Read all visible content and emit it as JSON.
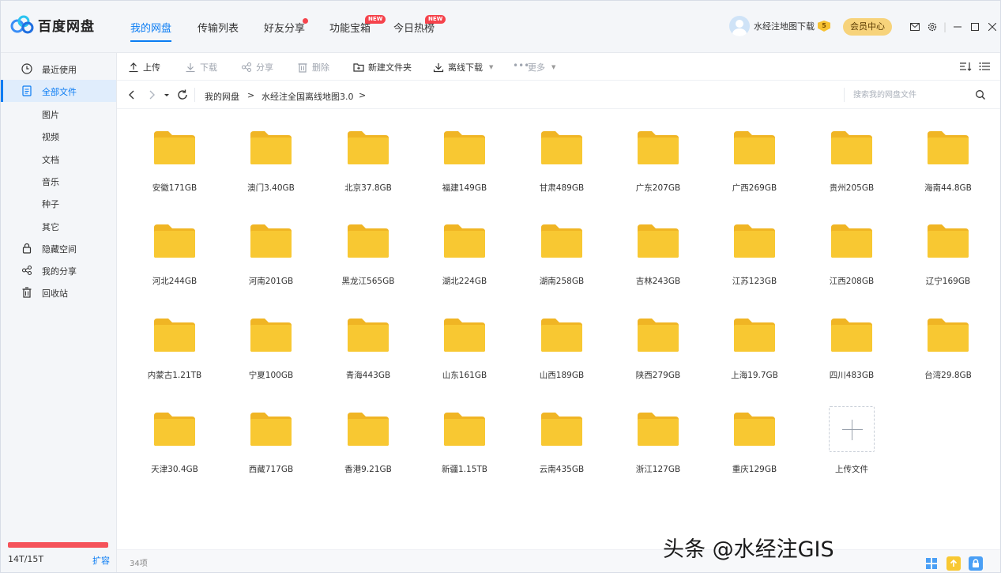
{
  "app": {
    "logo_text": "百度网盘"
  },
  "tabs": [
    {
      "label": "我的网盘"
    },
    {
      "label": "传输列表"
    },
    {
      "label": "好友分享"
    },
    {
      "label": "功能宝箱",
      "badge": "NEW"
    },
    {
      "label": "今日热榜",
      "badge": "NEW"
    }
  ],
  "user": {
    "name": "水经注地图下载",
    "vip_level": "5",
    "member_center": "会员中心"
  },
  "sidebar": {
    "items": [
      {
        "label": "最近使用",
        "icon": "clock-icon"
      },
      {
        "label": "全部文件",
        "icon": "file-icon"
      },
      {
        "label": "图片"
      },
      {
        "label": "视频"
      },
      {
        "label": "文档"
      },
      {
        "label": "音乐"
      },
      {
        "label": "种子"
      },
      {
        "label": "其它"
      },
      {
        "label": "隐藏空间",
        "icon": "lock-icon"
      },
      {
        "label": "我的分享",
        "icon": "share-icon"
      },
      {
        "label": "回收站",
        "icon": "trash-icon"
      }
    ],
    "storage": "14T/15T",
    "expand": "扩容"
  },
  "toolbar": {
    "upload": "上传",
    "download": "下载",
    "share": "分享",
    "delete": "删除",
    "new_folder": "新建文件夹",
    "offline_download": "离线下载",
    "more": "更多"
  },
  "breadcrumb": {
    "root": "我的网盘",
    "sep1": ">",
    "current": "水经注全国离线地图3.0",
    "sep2": ">"
  },
  "search": {
    "placeholder": "搜索我的网盘文件"
  },
  "folders": [
    "安徽171GB",
    "澳门3.40GB",
    "北京37.8GB",
    "福建149GB",
    "甘肃489GB",
    "广东207GB",
    "广西269GB",
    "贵州205GB",
    "海南44.8GB",
    "河北244GB",
    "河南201GB",
    "黑龙江565GB",
    "湖北224GB",
    "湖南258GB",
    "吉林243GB",
    "江苏123GB",
    "江西208GB",
    "辽宁169GB",
    "内蒙古1.21TB",
    "宁夏100GB",
    "青海443GB",
    "山东161GB",
    "山西189GB",
    "陕西279GB",
    "上海19.7GB",
    "四川483GB",
    "台湾29.8GB",
    "天津30.4GB",
    "西藏717GB",
    "香港9.21GB",
    "新疆1.15TB",
    "云南435GB",
    "浙江127GB",
    "重庆129GB"
  ],
  "upload_tile": {
    "label": "上传文件"
  },
  "status": {
    "count": "34项"
  },
  "watermark": "头条 @水经注GIS",
  "colors": {
    "accent": "#0a7cf3",
    "folder": "#f8c832",
    "storage_bar": "#f5535a",
    "badge": "#f5434c"
  }
}
